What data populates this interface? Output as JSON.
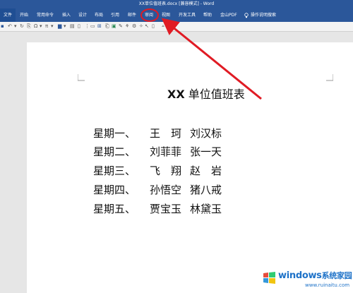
{
  "window": {
    "title": "XX单位值班表.docx [兼容模式] - Word"
  },
  "tabs": [
    {
      "label": "文件"
    },
    {
      "label": "开始"
    },
    {
      "label": "常用命令"
    },
    {
      "label": "插入"
    },
    {
      "label": "设计"
    },
    {
      "label": "布局"
    },
    {
      "label": "引用"
    },
    {
      "label": "邮件"
    },
    {
      "label": "审阅"
    },
    {
      "label": "视图"
    },
    {
      "label": "开发工具"
    },
    {
      "label": "帮助"
    },
    {
      "label": "金山PDF"
    },
    {
      "label": "操作说明搜索"
    }
  ],
  "document": {
    "title_prefix": "XX",
    "title_rest": " 单位值班表",
    "rows": [
      {
        "day": "星期一、",
        "name1": "王　珂",
        "name2": "刘汉标"
      },
      {
        "day": "星期二、",
        "name1": "刘菲菲",
        "name2": "张一天"
      },
      {
        "day": "星期三、",
        "name1": "飞　翔",
        "name2": "赵　岩"
      },
      {
        "day": "星期四、",
        "name1": "孙悟空",
        "name2": "猪八戒"
      },
      {
        "day": "星期五、",
        "name1": "贾宝玉",
        "name2": "林黛玉"
      }
    ]
  },
  "watermark": {
    "brand": "windows",
    "brand_suffix": "系统家园",
    "url": "www.ruinaitu.com"
  },
  "colors": {
    "ribbon": "#2b579a",
    "highlight": "#e01b24",
    "arrow": "#e01b24"
  },
  "icons": {
    "tell_me": "lightbulb-icon",
    "windows_logo": "windows-logo-icon"
  }
}
